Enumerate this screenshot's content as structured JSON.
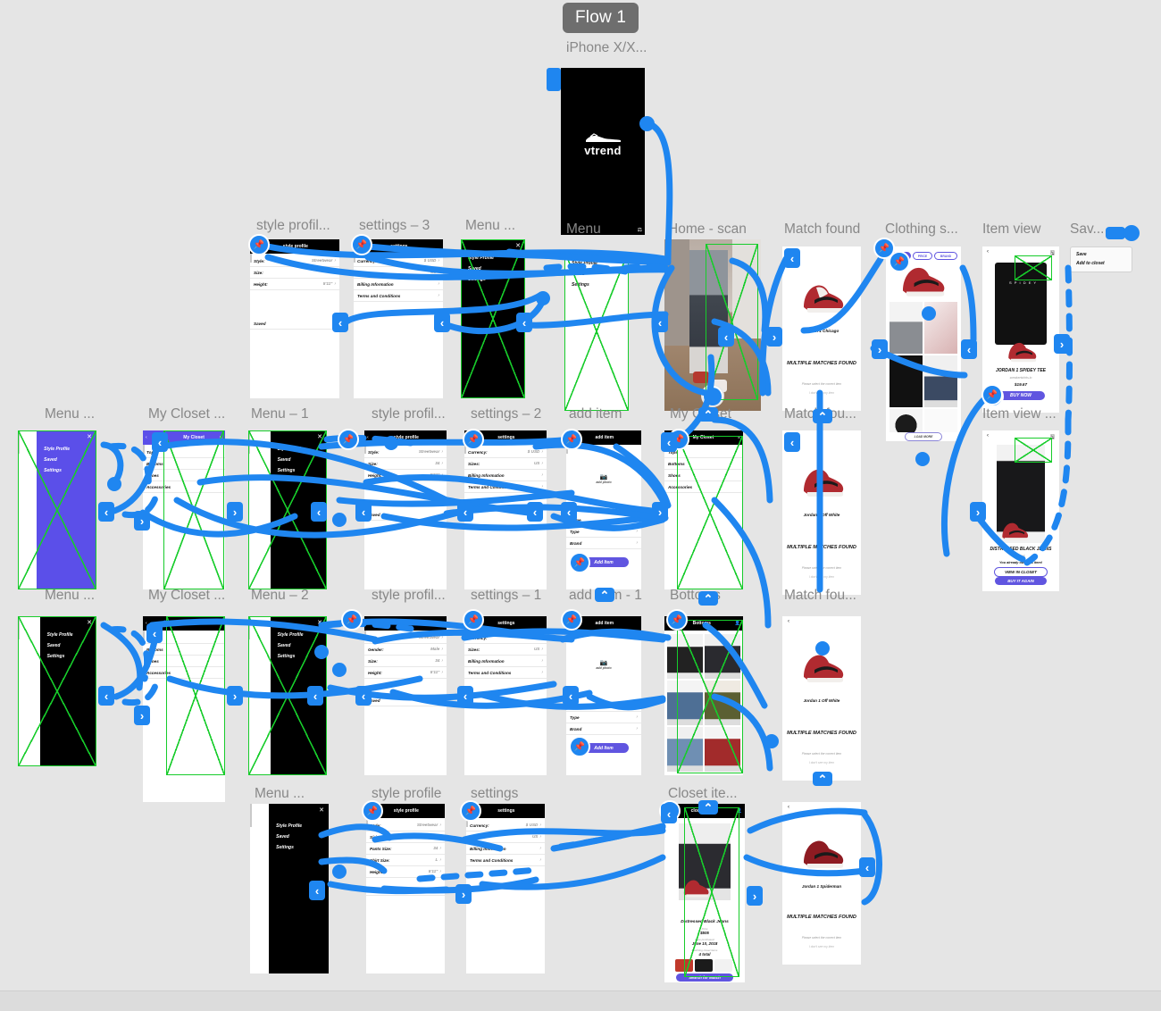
{
  "flow": {
    "badge": "Flow 1",
    "device_label": "iPhone X/X..."
  },
  "app": {
    "logo_text": "vtrend"
  },
  "frames": [
    {
      "id": "start",
      "label": ""
    },
    {
      "id": "menu_top",
      "label": "Menu"
    },
    {
      "id": "style_profile_4",
      "label": "style profil..."
    },
    {
      "id": "settings_3",
      "label": "settings – 3"
    },
    {
      "id": "menu_dark",
      "label": "Menu ..."
    },
    {
      "id": "add_item_top",
      "label": "add item"
    },
    {
      "id": "home_scan",
      "label": "Home - scan"
    },
    {
      "id": "match_found",
      "label": "Match found"
    },
    {
      "id": "clothing_sugg",
      "label": "Clothing s..."
    },
    {
      "id": "item_view",
      "label": "Item view"
    },
    {
      "id": "saved",
      "label": "Sav..."
    },
    {
      "id": "menu_left_1",
      "label": "Menu ..."
    },
    {
      "id": "my_closet_1",
      "label": "My Closet ..."
    },
    {
      "id": "menu_1",
      "label": "Menu – 1"
    },
    {
      "id": "style_profil_2",
      "label": "style profil..."
    },
    {
      "id": "settings_2",
      "label": "settings – 2"
    },
    {
      "id": "add_item",
      "label": "add item"
    },
    {
      "id": "my_closet_2",
      "label": "My Closet"
    },
    {
      "id": "match_fou_2",
      "label": "Match fou..."
    },
    {
      "id": "item_view_2",
      "label": "Item view ..."
    },
    {
      "id": "menu_left_2",
      "label": "Menu ..."
    },
    {
      "id": "my_closet_3",
      "label": "My Closet ..."
    },
    {
      "id": "menu_2",
      "label": "Menu – 2"
    },
    {
      "id": "style_profil_3",
      "label": "style profil..."
    },
    {
      "id": "settings_1",
      "label": "settings – 1"
    },
    {
      "id": "add_item_1",
      "label": "add item - 1"
    },
    {
      "id": "bottoms",
      "label": "Bottoms"
    },
    {
      "id": "match_fou_3",
      "label": "Match fou..."
    },
    {
      "id": "menu_bottom",
      "label": "Menu ..."
    },
    {
      "id": "style_profile",
      "label": "style profile"
    },
    {
      "id": "settings",
      "label": "settings"
    },
    {
      "id": "closet_item",
      "label": "Closet ite..."
    }
  ],
  "menu": {
    "close_icon": "close-icon",
    "items": [
      "Style Profile",
      "Saved",
      "Settings"
    ]
  },
  "style_profile_full": {
    "nav_title": "style profile",
    "rows": [
      {
        "label": "Style:",
        "value": "Streetwear"
      },
      {
        "label": "Sizing:",
        "value": "Mens"
      },
      {
        "label": "Pants Size:",
        "value": "34"
      },
      {
        "label": "Shirt Size:",
        "value": "L"
      },
      {
        "label": "Height:",
        "value": "5'11\""
      }
    ],
    "saved_row": "Saved"
  },
  "style_profile_short": {
    "nav_title": "style profile",
    "rows": [
      {
        "label": "Style:",
        "value": "Streetwear"
      },
      {
        "label": "Size:",
        "value": "34"
      },
      {
        "label": "Height:",
        "value": "5'11\""
      }
    ],
    "saved_row": "Saved"
  },
  "style_profile_gender": {
    "nav_title": "style profile",
    "rows": [
      {
        "label": "Style:",
        "value": "Streetwear"
      },
      {
        "label": "Gender:",
        "value": "Male"
      },
      {
        "label": "Size:",
        "value": "34"
      },
      {
        "label": "Height:",
        "value": "5'11\""
      }
    ],
    "saved_row": "Saved"
  },
  "settings": {
    "nav_title": "settings",
    "rows": [
      {
        "label": "Currency:",
        "value": "$ USD"
      },
      {
        "label": "Sizes:",
        "value": "US"
      },
      {
        "label": "Billing Information",
        "value": ""
      },
      {
        "label": "Terms and Conditions",
        "value": ""
      }
    ]
  },
  "my_closet": {
    "nav_title": "My Closet",
    "back_icon": "back-chevron-icon",
    "profile_icon": "person-icon",
    "categories": [
      "Tops",
      "Bottoms",
      "Shoes",
      "Accessories"
    ]
  },
  "add_item": {
    "nav_title": "add item",
    "photo_icon": "camera-icon",
    "photo_label": "add photo",
    "fields": [
      {
        "label": "Name",
        "value": ""
      },
      {
        "label": "Type",
        "value": ""
      },
      {
        "label": "Brand",
        "value": ""
      }
    ],
    "submit_label": "Add Item"
  },
  "match_found": {
    "headline": "MULTIPLE MATCHES FOUND",
    "sub": "Please select the correct item",
    "secondary": "I don't see my item",
    "results": [
      {
        "name": "Jordan 1 Chicago"
      },
      {
        "name": "Jordan 1 Off White"
      },
      {
        "name": "Jordan 1 Spiderman"
      }
    ]
  },
  "clothing_suggestions": {
    "filters": [
      "HOT",
      "PRICE",
      "BRAND"
    ],
    "load_more": "LOAD MORE"
  },
  "item_view_tee": {
    "title": "JORDAN 1 SPIDEY TEE",
    "brand": "sneakertshirts.io",
    "price": "$19.67",
    "cta": "BUY NOW",
    "back_icon": "back-chevron-icon",
    "save_icon": "save-icon"
  },
  "item_view_jeans": {
    "title": "DISTRESSED BLACK JEANS",
    "brand": "ASOS",
    "owned_note": "You already own this item!",
    "cta_secondary": "VIEW IN CLOSET",
    "cta_primary": "BUY IT AGAIN"
  },
  "closet_item": {
    "nav_title": "closet item",
    "title": "Distressed Black Jeans",
    "price_label": "Price",
    "price": "$505",
    "date_label": "Date purchased",
    "date": "June 10, 2018",
    "matching_label": "Matching closet items",
    "matching_count": "4 total",
    "cta": "Search for Match"
  },
  "saved_popup": {
    "items": [
      "Save",
      "Add to closet"
    ]
  },
  "colors": {
    "canvas": "#e5e5e5",
    "connector": "#1f86f0",
    "placeholder_green": "#17cc2b",
    "brand_purple": "#6055e0",
    "menu_purple": "#5b4fe9",
    "flow_badge": "#6e6e6e"
  },
  "icons": {
    "pin": "pin-icon",
    "arrow_left": "‹",
    "arrow_right": "›",
    "arrow_up": "⌃",
    "close": "✕",
    "camera": "camera-icon"
  }
}
